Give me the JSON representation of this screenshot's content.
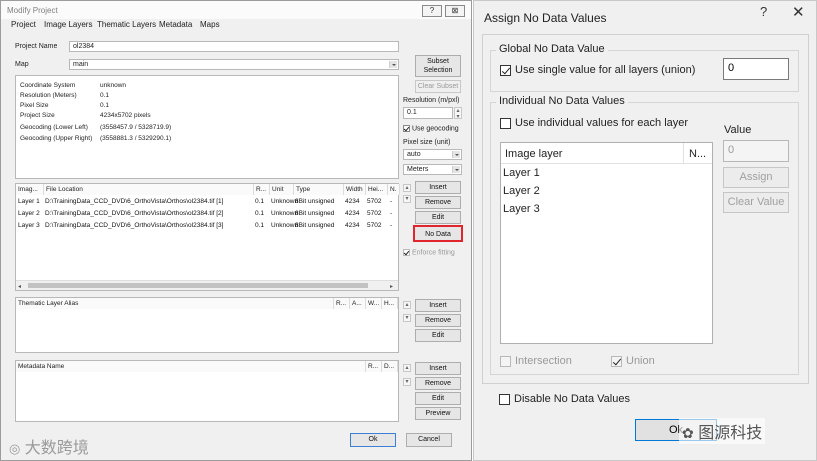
{
  "left": {
    "title": "Modify Project",
    "title_buttons": [
      "?",
      "⊠"
    ],
    "menu": [
      "Project",
      "Image Layers",
      "Thematic Layers",
      "Metadata",
      "Maps"
    ],
    "project_name_label": "Project Name",
    "project_name_value": "ol2384",
    "map_label": "Map",
    "map_value": "main",
    "subset_button": "Subset Selection",
    "clear_subset_button": "Clear Subset",
    "info": [
      {
        "key": "Coordinate System",
        "value": "unknown"
      },
      {
        "key": "Resolution (Meters)",
        "value": "0.1"
      },
      {
        "key": "Pixel Size",
        "value": "0.1"
      },
      {
        "key": "Project Size",
        "value": "4234x5702 pixels"
      },
      {
        "key": "Geocoding (Lower Left)",
        "value": "(3558457.9 / 5328719.9)"
      },
      {
        "key": "Geocoding (Upper Right)",
        "value": "(3558881.3 / 5329290.1)"
      }
    ],
    "resolution_label": "Resolution (m/pxl)",
    "resolution_value": "0.1",
    "use_geocoding_label": "Use geocoding",
    "pixel_size_label": "Pixel size (unit)",
    "pixel_size_value": "auto",
    "unit_value": "Meters",
    "layer_columns": [
      "Imag...",
      "File Location",
      "R...",
      "Unit",
      "Type",
      "Width",
      "Hei...",
      "N."
    ],
    "layers": [
      [
        "Layer 1",
        "D:\\TrainingData_CCD_DVD\\6_OrthoVista\\Orthos\\ol2384.tif [1]",
        "0.1",
        "Unknown",
        "8Bit unsigned",
        "4234",
        "5702",
        "-"
      ],
      [
        "Layer 2",
        "D:\\TrainingData_CCD_DVD\\6_OrthoVista\\Orthos\\ol2384.tif [2]",
        "0.1",
        "Unknown",
        "8Bit unsigned",
        "4234",
        "5702",
        "-"
      ],
      [
        "Layer 3",
        "D:\\TrainingData_CCD_DVD\\6_OrthoVista\\Orthos\\ol2384.tif [3]",
        "0.1",
        "Unknown",
        "8Bit unsigned",
        "4234",
        "5702",
        "-"
      ]
    ],
    "layer_buttons": {
      "insert": "Insert",
      "remove": "Remove",
      "edit": "Edit",
      "nodata": "No Data"
    },
    "enforce_fitting_label": "Enforce fitting",
    "thematic_columns": [
      "Thematic Layer Alias",
      "R...",
      "A...",
      "W...",
      "H..."
    ],
    "thematic_buttons": {
      "insert": "Insert",
      "remove": "Remove",
      "edit": "Edit"
    },
    "metadata_columns": [
      "Metadata Name",
      "R...",
      "D..."
    ],
    "metadata_buttons": {
      "insert": "Insert",
      "remove": "Remove",
      "edit": "Edit",
      "preview": "Preview"
    },
    "ok": "Ok",
    "cancel": "Cancel",
    "watermark": "大数跨境"
  },
  "right": {
    "title": "Assign No Data Values",
    "help": "?",
    "close": "✕",
    "global_group": "Global No Data Value",
    "single_value_label": "Use single value for all layers (union)",
    "global_value": "0",
    "individual_group": "Individual No Data Values",
    "individual_label": "Use individual values for each layer",
    "value_label": "Value",
    "value_input": "0",
    "columns": [
      "Image layer",
      "N..."
    ],
    "rows": [
      "Layer 1",
      "Layer 2",
      "Layer 3"
    ],
    "assign": "Assign",
    "clear_value": "Clear Value",
    "intersection": "Intersection",
    "union": "Union",
    "disable_label": "Disable No Data Values",
    "ok": "Ok",
    "watermark": "图源科技"
  },
  "colors": {
    "highlight": "#e0262c",
    "selected_row": "#cce4f7"
  }
}
